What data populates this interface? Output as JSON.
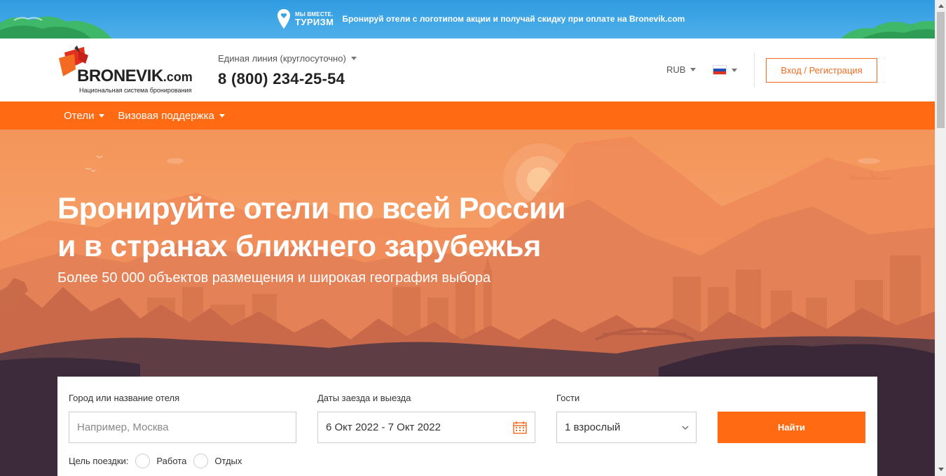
{
  "promo": {
    "brand_small": "МЫ ВМЕСТЕ.",
    "brand_big": "ТУРИЗМ",
    "text": "Бронируй отели с логотипом акции и получай скидку при оплате на Bronevik.com"
  },
  "header": {
    "logo_word": "BRONEVIK",
    "logo_com": ".com",
    "logo_sub": "Национальная система бронирования",
    "hotline_label": "Единая линия (круглосуточно)",
    "phone": "8 (800) 234-25-54",
    "currency": "RUB",
    "login_label": "Вход / Регистрация"
  },
  "nav": {
    "items": [
      {
        "label": "Отели"
      },
      {
        "label": "Визовая поддержка"
      }
    ]
  },
  "hero": {
    "title_line1": "Бронируйте отели по всей России",
    "title_line2": "и в странах ближнего зарубежья",
    "subtitle": "Более 50 000 объектов размещения и широкая география выбора"
  },
  "search": {
    "city_label": "Город или название отеля",
    "city_placeholder": "Например, Москва",
    "dates_label": "Даты заезда и выезда",
    "dates_value": "6 Окт 2022 - 7 Окт 2022",
    "guests_label": "Гости",
    "guests_value": "1 взрослый",
    "find_label": "Найти",
    "purpose_label": "Цель поездки:",
    "purpose_options": [
      "Работа",
      "Отдых"
    ]
  },
  "colors": {
    "accent": "#ff6a13",
    "promo_blue": "#3aa3e4"
  }
}
